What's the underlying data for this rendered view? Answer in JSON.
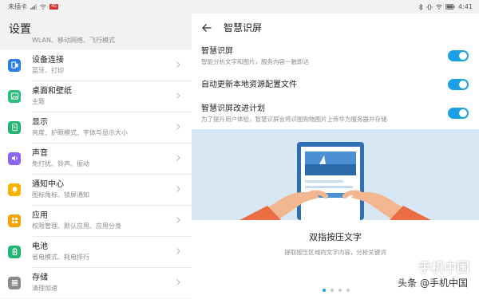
{
  "left_status": {
    "carrier": "未插卡",
    "signal_label": "4G"
  },
  "settings_title": "设置",
  "cutoff_text": "WLAN、移动网络、飞行模式",
  "menu": [
    {
      "title": "设备连接",
      "sub": "蓝牙、打印",
      "icon": "device-connection-icon",
      "color": "#2b7de9"
    },
    {
      "title": "桌面和壁纸",
      "sub": "主题",
      "icon": "wallpaper-icon",
      "color": "#2bbd7e"
    },
    {
      "title": "显示",
      "sub": "亮度、护眼模式、字体与显示大小",
      "icon": "display-icon",
      "color": "#22b573"
    },
    {
      "title": "声音",
      "sub": "免打扰、铃声、振动",
      "icon": "sound-icon",
      "color": "#8e63f0"
    },
    {
      "title": "通知中心",
      "sub": "图标角标、锁屏通知",
      "icon": "notification-icon",
      "color": "#f5b400"
    },
    {
      "title": "应用",
      "sub": "权限管理、默认应用、应用分身",
      "icon": "apps-icon",
      "color": "#f5a300"
    },
    {
      "title": "电池",
      "sub": "省电模式、耗电排行",
      "icon": "battery-icon",
      "color": "#22b573"
    },
    {
      "title": "存储",
      "sub": "清理加速",
      "icon": "storage-icon",
      "color": "#8a8a8a"
    }
  ],
  "right_status": {
    "battery": "",
    "time": "4:41"
  },
  "page_title": "智慧识屏",
  "settings": [
    {
      "title": "智慧识屏",
      "sub": "智能分析文字和图片，服务内容一触即达",
      "enabled": true
    },
    {
      "title": "自动更新本地资源配置文件",
      "sub": "",
      "enabled": true
    },
    {
      "title": "智慧识屏改进计划",
      "sub": "为了提升用户体验，智慧识屏会将识图购物图片上传华为服务器并存储",
      "enabled": true
    }
  ],
  "feature": {
    "title": "双指按压文字",
    "desc": "提取按压区域的文字内容，分析关键词"
  },
  "pager": {
    "count": 4,
    "active": 0
  },
  "watermark": {
    "logo": "手机中国",
    "source": "头条 @手机中国"
  },
  "colors": {
    "accent": "#1aa0e5",
    "illustration_bg": "#d7e8f4"
  }
}
